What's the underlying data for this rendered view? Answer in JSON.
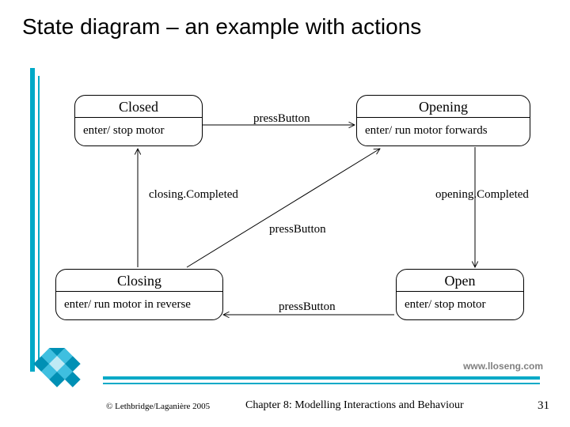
{
  "title": "State diagram – an example with actions",
  "states": {
    "closed": {
      "name": "Closed",
      "action": "enter/ stop motor"
    },
    "opening": {
      "name": "Opening",
      "action": "enter/ run motor forwards"
    },
    "closing": {
      "name": "Closing",
      "action": "enter/ run motor in reverse"
    },
    "open": {
      "name": "Open",
      "action": "enter/ stop motor"
    }
  },
  "transitions": {
    "closed_to_opening": "pressButton",
    "opening_to_open": "opening.Completed",
    "open_to_closing": "pressButton",
    "closing_to_closed": "closing.Completed",
    "closing_to_opening": "pressButton"
  },
  "footer": {
    "site": "www.lloseng.com",
    "copyright": "© Lethbridge/Laganière 2005",
    "chapter": "Chapter 8: Modelling Interactions and Behaviour",
    "page": "31"
  },
  "colors": {
    "accent": "#00a9c7"
  }
}
